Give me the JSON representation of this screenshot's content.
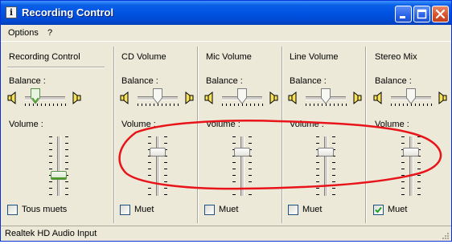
{
  "window": {
    "title": "Recording Control",
    "app_icon_glyph": "i"
  },
  "menu": {
    "options": "Options",
    "help": "?"
  },
  "strips": [
    {
      "title": "Recording Control",
      "balance_label": "Balance :",
      "volume_label": "Volume :",
      "mute_label": "Tous muets",
      "muted": false,
      "volume_level": 0.35,
      "balance": 0.25,
      "selected": true
    },
    {
      "title": "CD Volume",
      "balance_label": "Balance :",
      "volume_label": "Volume :",
      "mute_label": "Muet",
      "muted": false,
      "volume_level": 0.75,
      "balance": 0.5,
      "selected": false
    },
    {
      "title": "Mic Volume",
      "balance_label": "Balance :",
      "volume_label": "Volume :",
      "mute_label": "Muet",
      "muted": false,
      "volume_level": 0.75,
      "balance": 0.5,
      "selected": false
    },
    {
      "title": "Line Volume",
      "balance_label": "Balance :",
      "volume_label": "Volume :",
      "mute_label": "Muet",
      "muted": false,
      "volume_level": 0.75,
      "balance": 0.5,
      "selected": false
    },
    {
      "title": "Stereo Mix",
      "balance_label": "Balance :",
      "volume_label": "Volume :",
      "mute_label": "Muet",
      "muted": true,
      "volume_level": 0.75,
      "balance": 0.5,
      "selected": false
    }
  ],
  "status": {
    "device": "Realtek HD Audio Input"
  },
  "colors": {
    "title_bar": "#0054e3",
    "window_face": "#ece9d8",
    "annotation": "#e8141a",
    "checkmark": "#21a121"
  },
  "icons": {
    "minimize": "minimize-icon",
    "maximize": "maximize-icon",
    "close": "close-icon",
    "speaker_left": "speaker-left-icon",
    "speaker_right": "speaker-right-icon"
  }
}
